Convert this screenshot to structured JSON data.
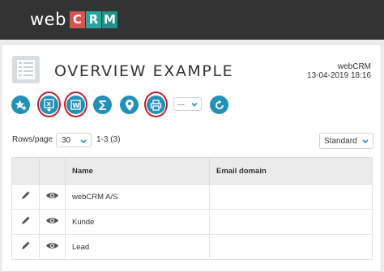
{
  "app": {
    "logo_prefix": "web",
    "logo_letters": [
      {
        "letter": "C",
        "color": "#d9534f"
      },
      {
        "letter": "R",
        "color": "#2aa6a0"
      },
      {
        "letter": "M",
        "color": "#1e8f8a"
      }
    ]
  },
  "header": {
    "title": "OVERVIEW EXAMPLE",
    "user": "webCRM",
    "datetime": "13-04-2019 18:16"
  },
  "toolbar": {
    "buttons": [
      {
        "name": "add-favorite-button",
        "icon": "star-plus-icon",
        "highlighted": false
      },
      {
        "name": "export-excel-button",
        "icon": "excel-export-icon",
        "highlighted": true
      },
      {
        "name": "export-word-button",
        "icon": "word-export-icon",
        "highlighted": true
      },
      {
        "name": "sum-button",
        "icon": "sigma-icon",
        "highlighted": false
      },
      {
        "name": "map-button",
        "icon": "map-pin-icon",
        "highlighted": false
      },
      {
        "name": "print-button",
        "icon": "printer-icon",
        "highlighted": true
      },
      {
        "name": "reset-button",
        "icon": "refresh-icon",
        "highlighted": false
      }
    ],
    "more_select": "---",
    "accent_color": "#2391b5",
    "highlight_color": "#c0212b"
  },
  "pager": {
    "rows_label": "Rows/page",
    "rows_value": "30",
    "range": "1-3 (3)",
    "view_value": "Standard"
  },
  "table": {
    "columns": [
      "Name",
      "Email domain"
    ],
    "rows": [
      {
        "name": "webCRM A/S",
        "email_domain": ""
      },
      {
        "name": "Kunde",
        "email_domain": ""
      },
      {
        "name": "Lead",
        "email_domain": ""
      }
    ]
  }
}
